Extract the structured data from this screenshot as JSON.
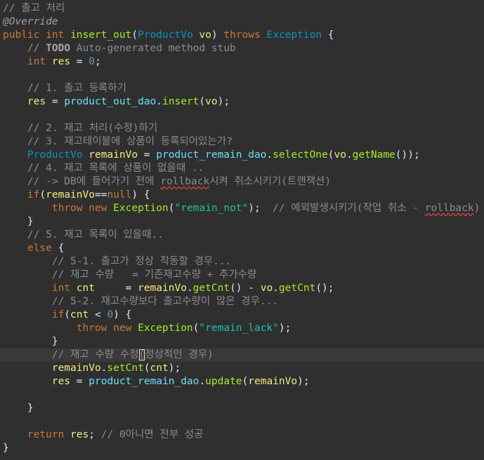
{
  "editor": {
    "colors": {
      "background": "#2f2f2f",
      "current_line": "#3a3a3a",
      "keyword": "#cc7832",
      "type": "#1290c3",
      "variable": "#f3ec79",
      "field": "#66e1f8",
      "method": "#a7ec21",
      "number": "#6897bb",
      "string": "#17c6a3",
      "comment": "#8c8c8c"
    },
    "current_line_index": 26,
    "lines": [
      [
        [
          "comment",
          "// 출고 처리"
        ]
      ],
      [
        [
          "ann",
          "@Override"
        ]
      ],
      [
        [
          "kw",
          "public"
        ],
        [
          "plain",
          " "
        ],
        [
          "kw",
          "int"
        ],
        [
          "plain",
          " "
        ],
        [
          "method",
          "insert_out"
        ],
        [
          "plain",
          "("
        ],
        [
          "type",
          "ProductVo"
        ],
        [
          "plain",
          " "
        ],
        [
          "var",
          "vo"
        ],
        [
          "plain",
          ") "
        ],
        [
          "kw",
          "throws"
        ],
        [
          "plain",
          " "
        ],
        [
          "type",
          "Exception"
        ],
        [
          "plain",
          " {"
        ]
      ],
      [
        [
          "plain",
          "    "
        ],
        [
          "comment",
          "// "
        ],
        [
          "todo",
          "TODO"
        ],
        [
          "comment",
          " Auto-generated method stub"
        ]
      ],
      [
        [
          "plain",
          "    "
        ],
        [
          "kw",
          "int"
        ],
        [
          "plain",
          " "
        ],
        [
          "var",
          "res"
        ],
        [
          "plain",
          " = "
        ],
        [
          "num",
          "0"
        ],
        [
          "plain",
          ";"
        ]
      ],
      [],
      [
        [
          "plain",
          "    "
        ],
        [
          "comment",
          "// 1. 출고 등록하기"
        ]
      ],
      [
        [
          "plain",
          "    "
        ],
        [
          "var",
          "res"
        ],
        [
          "plain",
          " = "
        ],
        [
          "field",
          "product_out_dao"
        ],
        [
          "plain",
          "."
        ],
        [
          "method",
          "insert"
        ],
        [
          "plain",
          "("
        ],
        [
          "var",
          "vo"
        ],
        [
          "plain",
          ");"
        ]
      ],
      [],
      [
        [
          "plain",
          "    "
        ],
        [
          "comment",
          "// 2. 재고 처리(수정)하기"
        ]
      ],
      [
        [
          "plain",
          "    "
        ],
        [
          "comment",
          "// 3. 재고테이블에 상품이 등록되어있는가?"
        ]
      ],
      [
        [
          "plain",
          "    "
        ],
        [
          "type",
          "ProductVo"
        ],
        [
          "plain",
          " "
        ],
        [
          "var",
          "remainVo"
        ],
        [
          "plain",
          " = "
        ],
        [
          "field",
          "product_remain_dao"
        ],
        [
          "plain",
          "."
        ],
        [
          "method",
          "selectOne"
        ],
        [
          "plain",
          "("
        ],
        [
          "var",
          "vo"
        ],
        [
          "plain",
          "."
        ],
        [
          "method",
          "getName"
        ],
        [
          "plain",
          "());"
        ]
      ],
      [
        [
          "plain",
          "    "
        ],
        [
          "comment",
          "// 4. 재고 목록에 상품이 없을때 .."
        ]
      ],
      [
        [
          "plain",
          "    "
        ],
        [
          "comment",
          "// -> DB에 들어가기 전에 "
        ],
        [
          "wavy",
          "rollback"
        ],
        [
          "comment",
          "시켜 취소시키기(트랜잭션)"
        ]
      ],
      [
        [
          "plain",
          "    "
        ],
        [
          "kw",
          "if"
        ],
        [
          "plain",
          "("
        ],
        [
          "var",
          "remainVo"
        ],
        [
          "plain",
          "=="
        ],
        [
          "kw",
          "null"
        ],
        [
          "plain",
          ") {"
        ]
      ],
      [
        [
          "plain",
          "        "
        ],
        [
          "kw",
          "throw"
        ],
        [
          "plain",
          " "
        ],
        [
          "kw",
          "new"
        ],
        [
          "plain",
          " "
        ],
        [
          "method",
          "Exception"
        ],
        [
          "plain",
          "("
        ],
        [
          "str",
          "\"remain_not\""
        ],
        [
          "plain",
          ");  "
        ],
        [
          "comment",
          "// 예외발생시키기(작업 취소 - "
        ],
        [
          "wavy",
          "rollback"
        ],
        [
          "comment",
          ")"
        ]
      ],
      [
        [
          "plain",
          "    }"
        ]
      ],
      [
        [
          "plain",
          "    "
        ],
        [
          "comment",
          "// 5. 재고 목록이 있을때.."
        ]
      ],
      [
        [
          "plain",
          "    "
        ],
        [
          "kw",
          "else"
        ],
        [
          "plain",
          " {"
        ]
      ],
      [
        [
          "plain",
          "        "
        ],
        [
          "comment",
          "// 5-1. 출고가 정상 작동할 경우..."
        ]
      ],
      [
        [
          "plain",
          "        "
        ],
        [
          "comment",
          "// 재고 수량   = 기존재고수량 + 추가수량"
        ]
      ],
      [
        [
          "plain",
          "        "
        ],
        [
          "kw",
          "int"
        ],
        [
          "plain",
          " "
        ],
        [
          "var",
          "cnt"
        ],
        [
          "plain",
          "     = "
        ],
        [
          "var",
          "remainVo"
        ],
        [
          "plain",
          "."
        ],
        [
          "method",
          "getCnt"
        ],
        [
          "plain",
          "() - "
        ],
        [
          "var",
          "vo"
        ],
        [
          "plain",
          "."
        ],
        [
          "method",
          "getCnt"
        ],
        [
          "plain",
          "();"
        ]
      ],
      [
        [
          "plain",
          "        "
        ],
        [
          "comment",
          "// 5-2. 재고수량보다 출고수량이 많은 경우..."
        ]
      ],
      [
        [
          "plain",
          "        "
        ],
        [
          "kw",
          "if"
        ],
        [
          "plain",
          "("
        ],
        [
          "var",
          "cnt"
        ],
        [
          "plain",
          " < "
        ],
        [
          "num",
          "0"
        ],
        [
          "plain",
          ") {"
        ]
      ],
      [
        [
          "plain",
          "            "
        ],
        [
          "kw",
          "throw"
        ],
        [
          "plain",
          " "
        ],
        [
          "kw",
          "new"
        ],
        [
          "plain",
          " "
        ],
        [
          "method",
          "Exception"
        ],
        [
          "plain",
          "("
        ],
        [
          "str",
          "\"remain_lack\""
        ],
        [
          "plain",
          ");"
        ]
      ],
      [
        [
          "plain",
          "        }"
        ]
      ],
      [
        [
          "plain",
          "        "
        ],
        [
          "comment",
          "// 재고 수량 수정"
        ],
        [
          "cursor",
          "("
        ],
        [
          "comment",
          "정상적인 경우)"
        ]
      ],
      [
        [
          "plain",
          "        "
        ],
        [
          "var",
          "remainVo"
        ],
        [
          "plain",
          "."
        ],
        [
          "method",
          "setCnt"
        ],
        [
          "plain",
          "("
        ],
        [
          "var",
          "cnt"
        ],
        [
          "plain",
          ");"
        ]
      ],
      [
        [
          "plain",
          "        "
        ],
        [
          "var",
          "res"
        ],
        [
          "plain",
          " = "
        ],
        [
          "field",
          "product_remain_dao"
        ],
        [
          "plain",
          "."
        ],
        [
          "method",
          "update"
        ],
        [
          "plain",
          "("
        ],
        [
          "var",
          "remainVo"
        ],
        [
          "plain",
          ");"
        ]
      ],
      [],
      [
        [
          "plain",
          "    }"
        ]
      ],
      [],
      [
        [
          "plain",
          "    "
        ],
        [
          "kw",
          "return"
        ],
        [
          "plain",
          " "
        ],
        [
          "var",
          "res"
        ],
        [
          "plain",
          "; "
        ],
        [
          "comment",
          "// 0아니면 전부 성공"
        ]
      ],
      [
        [
          "plain",
          "}"
        ]
      ]
    ]
  }
}
